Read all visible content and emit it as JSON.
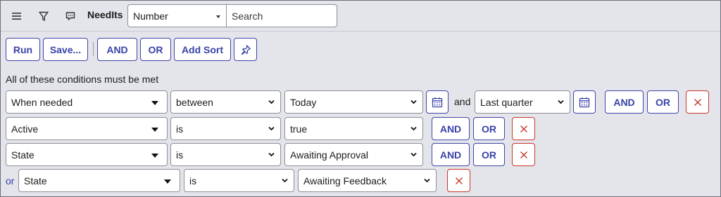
{
  "header": {
    "table_name": "NeedIts",
    "field_select": "Number",
    "search_placeholder": "Search"
  },
  "toolbar": {
    "run": "Run",
    "save": "Save...",
    "and": "AND",
    "or": "OR",
    "add_sort": "Add Sort"
  },
  "banner": "All of these conditions must be met",
  "conditions": [
    {
      "field": "When needed",
      "operator": "between",
      "value": "Today",
      "joiner": "and",
      "value2": "Last quarter",
      "and": "AND",
      "or": "OR"
    },
    {
      "field": "Active",
      "operator": "is",
      "value": "true",
      "and": "AND",
      "or": "OR"
    },
    {
      "field": "State",
      "operator": "is",
      "value": "Awaiting Approval",
      "and": "AND",
      "or": "OR"
    }
  ],
  "or_condition": {
    "prefix": "or",
    "field": "State",
    "operator": "is",
    "value": "Awaiting Feedback"
  },
  "colors": {
    "accent": "#3942a8",
    "delete": "#c8352b",
    "background": "#e4e5ea"
  },
  "icons": [
    "menu-icon",
    "filter-icon",
    "comment-icon",
    "pin-icon",
    "calendar-icon",
    "close-icon"
  ]
}
